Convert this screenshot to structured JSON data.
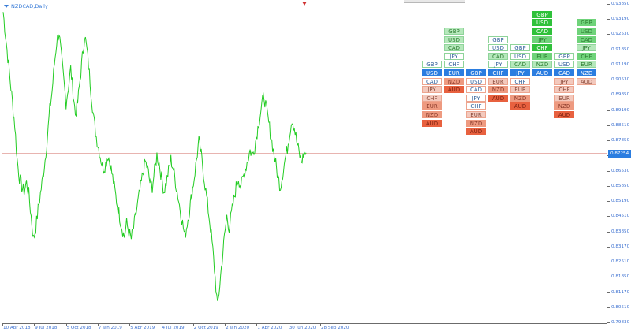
{
  "window": {
    "title": "NZDCAD,Daily"
  },
  "price_axis": {
    "labels": [
      "0.93850",
      "0.93190",
      "0.92530",
      "0.91850",
      "0.91190",
      "0.90530",
      "0.89850",
      "0.89190",
      "0.88510",
      "0.87850",
      "0.87254",
      "0.86530",
      "0.85850",
      "0.85190",
      "0.84510",
      "0.83850",
      "0.83170",
      "0.82510",
      "0.81850",
      "0.81170",
      "0.80510",
      "0.79830"
    ],
    "current_price": "0.87254"
  },
  "time_axis": {
    "labels": [
      "10 Apr 2018",
      "9 Jul 2018",
      "5 Oct 2018",
      "7 Jan 2019",
      "5 Apr 2019",
      "4 Jul 2019",
      "2 Oct 2019",
      "2 Jan 2020",
      "1 Apr 2020",
      "30 Jun 2020",
      "28 Sep 2020"
    ]
  },
  "colors": {
    "price_line": "#22cc22",
    "current_price_line": "#c0392b",
    "axis_text": "#3a6fd0",
    "base_cell": "#2b7de0",
    "strong_dark": "#2fc13a",
    "strong_medium": "#6fd37a",
    "strong_light": "#b5e8bb",
    "neutral_outline": "#e9f6ea",
    "weak_light": "#f3c9bd",
    "weak_medium": "#ee9a80",
    "weak_dark": "#e8613f"
  },
  "currency_strength": {
    "columns": [
      {
        "base": "USD",
        "above": [
          {
            "label": "GBP",
            "tone": "neutral"
          }
        ],
        "below": [
          {
            "label": "CAD",
            "tone": "weak-outline"
          },
          {
            "label": "JPY",
            "tone": "weak-light"
          },
          {
            "label": "CHF",
            "tone": "weak-light"
          },
          {
            "label": "EUR",
            "tone": "weak-medium"
          },
          {
            "label": "NZD",
            "tone": "weak-medium"
          },
          {
            "label": "AUD",
            "tone": "weak-dark"
          }
        ]
      },
      {
        "base": "EUR",
        "above": [
          {
            "label": "GBP",
            "tone": "strong-light"
          },
          {
            "label": "USD",
            "tone": "strong-light"
          },
          {
            "label": "CAD",
            "tone": "strong-light"
          },
          {
            "label": "JPY",
            "tone": "neutral"
          },
          {
            "label": "CHF",
            "tone": "neutral"
          }
        ],
        "below": [
          {
            "label": "NZD",
            "tone": "weak-medium"
          },
          {
            "label": "AUD",
            "tone": "weak-dark"
          }
        ]
      },
      {
        "base": "GBP",
        "above": [],
        "below": [
          {
            "label": "USD",
            "tone": "weak-outline"
          },
          {
            "label": "CAD",
            "tone": "weak-outline"
          },
          {
            "label": "JPY",
            "tone": "weak-outline"
          },
          {
            "label": "CHF",
            "tone": "weak-outline"
          },
          {
            "label": "EUR",
            "tone": "weak-light"
          },
          {
            "label": "NZD",
            "tone": "weak-medium"
          },
          {
            "label": "AUD",
            "tone": "weak-dark"
          }
        ]
      },
      {
        "base": "CHF",
        "above": [
          {
            "label": "GBP",
            "tone": "neutral"
          },
          {
            "label": "USD",
            "tone": "neutral"
          },
          {
            "label": "CAD",
            "tone": "strong-light"
          },
          {
            "label": "JPY",
            "tone": "neutral"
          }
        ],
        "below": [
          {
            "label": "EUR",
            "tone": "weak-light"
          },
          {
            "label": "NZD",
            "tone": "weak-medium"
          },
          {
            "label": "AUD",
            "tone": "weak-dark"
          }
        ]
      },
      {
        "base": "JPY",
        "above": [
          {
            "label": "GBP",
            "tone": "neutral"
          },
          {
            "label": "USD",
            "tone": "neutral"
          },
          {
            "label": "CAD",
            "tone": "strong-light"
          }
        ],
        "below": [
          {
            "label": "CHF",
            "tone": "weak-outline"
          },
          {
            "label": "EUR",
            "tone": "weak-light"
          },
          {
            "label": "NZD",
            "tone": "weak-medium"
          },
          {
            "label": "AUD",
            "tone": "weak-dark"
          }
        ]
      },
      {
        "base": "AUD",
        "above": [
          {
            "label": "GBP",
            "tone": "strong-dark"
          },
          {
            "label": "USD",
            "tone": "strong-dark"
          },
          {
            "label": "CAD",
            "tone": "strong-dark"
          },
          {
            "label": "JPY",
            "tone": "strong-medium"
          },
          {
            "label": "CHF",
            "tone": "strong-dark"
          },
          {
            "label": "EUR",
            "tone": "strong-medium"
          },
          {
            "label": "NZD",
            "tone": "strong-light"
          }
        ],
        "below": []
      },
      {
        "base": "CAD",
        "above": [
          {
            "label": "GBP",
            "tone": "neutral"
          },
          {
            "label": "USD",
            "tone": "neutral"
          }
        ],
        "below": [
          {
            "label": "JPY",
            "tone": "weak-light"
          },
          {
            "label": "CHF",
            "tone": "weak-light"
          },
          {
            "label": "EUR",
            "tone": "weak-light"
          },
          {
            "label": "NZD",
            "tone": "weak-medium"
          },
          {
            "label": "AUD",
            "tone": "weak-dark"
          }
        ]
      },
      {
        "base": "NZD",
        "above": [
          {
            "label": "GBP",
            "tone": "strong-medium"
          },
          {
            "label": "USD",
            "tone": "strong-medium"
          },
          {
            "label": "CAD",
            "tone": "strong-medium"
          },
          {
            "label": "JPY",
            "tone": "strong-light"
          },
          {
            "label": "CHF",
            "tone": "strong-medium"
          },
          {
            "label": "EUR",
            "tone": "strong-light"
          }
        ],
        "below": [
          {
            "label": "AUD",
            "tone": "weak-light"
          }
        ]
      }
    ]
  },
  "chart_data": {
    "type": "line",
    "symbol": "NZDCAD",
    "timeframe": "Daily",
    "x": [
      "10 Apr 2018",
      "9 Jul 2018",
      "5 Oct 2018",
      "7 Jan 2019",
      "5 Apr 2019",
      "4 Jul 2019",
      "2 Oct 2019",
      "2 Jan 2020",
      "1 Apr 2020",
      "30 Jun 2020",
      "28 Sep 2020"
    ],
    "ylim": [
      0.7983,
      0.9385
    ],
    "current_price": 0.87254,
    "series": [
      {
        "values": [
          0.935,
          0.925,
          0.915,
          0.905,
          0.895,
          0.885,
          0.87,
          0.862,
          0.858,
          0.856,
          0.86,
          0.855,
          0.845,
          0.835,
          0.84,
          0.848,
          0.855,
          0.862,
          0.87,
          0.88,
          0.892,
          0.9,
          0.912,
          0.922,
          0.926,
          0.915,
          0.905,
          0.895,
          0.902,
          0.91,
          0.9,
          0.89,
          0.895,
          0.905,
          0.915,
          0.925,
          0.918,
          0.908,
          0.897,
          0.887,
          0.88,
          0.875,
          0.87,
          0.866,
          0.868,
          0.872,
          0.868,
          0.862,
          0.856,
          0.85,
          0.845,
          0.84,
          0.836,
          0.842,
          0.838,
          0.835,
          0.84,
          0.846,
          0.852,
          0.858,
          0.864,
          0.869,
          0.866,
          0.86,
          0.858,
          0.865,
          0.872,
          0.868,
          0.862,
          0.856,
          0.86,
          0.865,
          0.87,
          0.866,
          0.86,
          0.854,
          0.848,
          0.842,
          0.836,
          0.842,
          0.848,
          0.855,
          0.862,
          0.87,
          0.878,
          0.872,
          0.864,
          0.856,
          0.848,
          0.84,
          0.83,
          0.818,
          0.805,
          0.815,
          0.826,
          0.836,
          0.845,
          0.84,
          0.846,
          0.852,
          0.858,
          0.862,
          0.858,
          0.862,
          0.866,
          0.87,
          0.874,
          0.872,
          0.876,
          0.882,
          0.888,
          0.894,
          0.898,
          0.892,
          0.886,
          0.88,
          0.874,
          0.868,
          0.862,
          0.858,
          0.864,
          0.87,
          0.875,
          0.882,
          0.888,
          0.884,
          0.878,
          0.873,
          0.869,
          0.872,
          0.873
        ]
      }
    ]
  }
}
